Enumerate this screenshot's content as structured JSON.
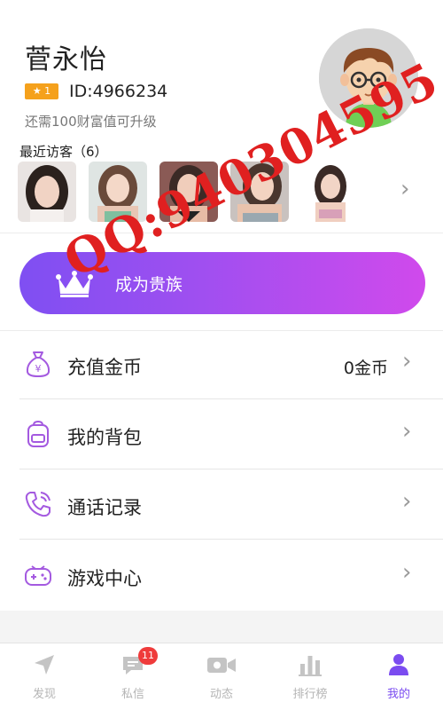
{
  "profile": {
    "name": "菅永怡",
    "level_badge": "★ 1",
    "user_id": "ID:4966234",
    "upgrade_hint": "还需100财富值可升级"
  },
  "visitors": {
    "title": "最近访客（6）",
    "count": 6
  },
  "noble_banner": {
    "label": "成为贵族",
    "icon": "crown-icon"
  },
  "menu": [
    {
      "label": "充值金币",
      "value": "0金币",
      "icon": "money-bag-icon"
    },
    {
      "label": "我的背包",
      "value": "",
      "icon": "backpack-icon"
    },
    {
      "label": "通话记录",
      "value": "",
      "icon": "phone-call-icon"
    },
    {
      "label": "游戏中心",
      "value": "",
      "icon": "gamepad-icon"
    }
  ],
  "tabs": [
    {
      "label": "发现",
      "icon": "navigation-arrow-icon",
      "active": false
    },
    {
      "label": "私信",
      "icon": "message-icon",
      "badge": "11",
      "active": false
    },
    {
      "label": "动态",
      "icon": "video-camera-icon",
      "active": false
    },
    {
      "label": "排行榜",
      "icon": "bar-chart-icon",
      "active": false
    },
    {
      "label": "我的",
      "icon": "user-icon",
      "active": true
    }
  ],
  "watermark": "QQ:940304595",
  "colors": {
    "accent": "#7b4cf0",
    "banner_start": "#7f4ff2",
    "banner_end": "#d04aec",
    "level_badge": "#f5a11c",
    "notification_badge": "#ef3b3b",
    "watermark": "#e02020"
  }
}
